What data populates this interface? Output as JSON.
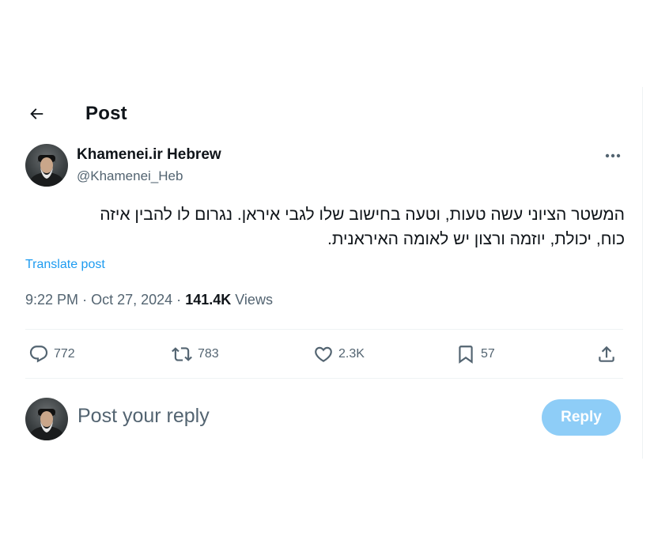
{
  "header": {
    "title": "Post"
  },
  "author": {
    "display_name": "Khamenei.ir Hebrew",
    "handle": "@Khamenei_Heb"
  },
  "post": {
    "text_line1": "המשטר הציוני עשה טעות, וטעה בחישוב שלו לגבי איראן. נגרום לו להבין איזה",
    "text_line2": "כוח, יכולת, יוזמה ורצון יש לאומה האיראנית.",
    "translate_label": "Translate post",
    "time": "9:22 PM",
    "separator": "·",
    "date": "Oct 27, 2024",
    "views_count": "141.4K",
    "views_label": "Views"
  },
  "actions": {
    "replies": "772",
    "reposts": "783",
    "likes": "2.3K",
    "bookmarks": "57"
  },
  "reply": {
    "placeholder": "Post your reply",
    "button_label": "Reply"
  },
  "icons": {
    "back": "arrow-left-icon",
    "more": "more-horizontal-icon",
    "reply": "comment-icon",
    "repost": "repost-icon",
    "like": "heart-icon",
    "bookmark": "bookmark-icon",
    "share": "share-icon"
  },
  "colors": {
    "accent": "#1d9bf0",
    "reply_button": "#8ecdf7",
    "secondary_text": "#536471"
  }
}
